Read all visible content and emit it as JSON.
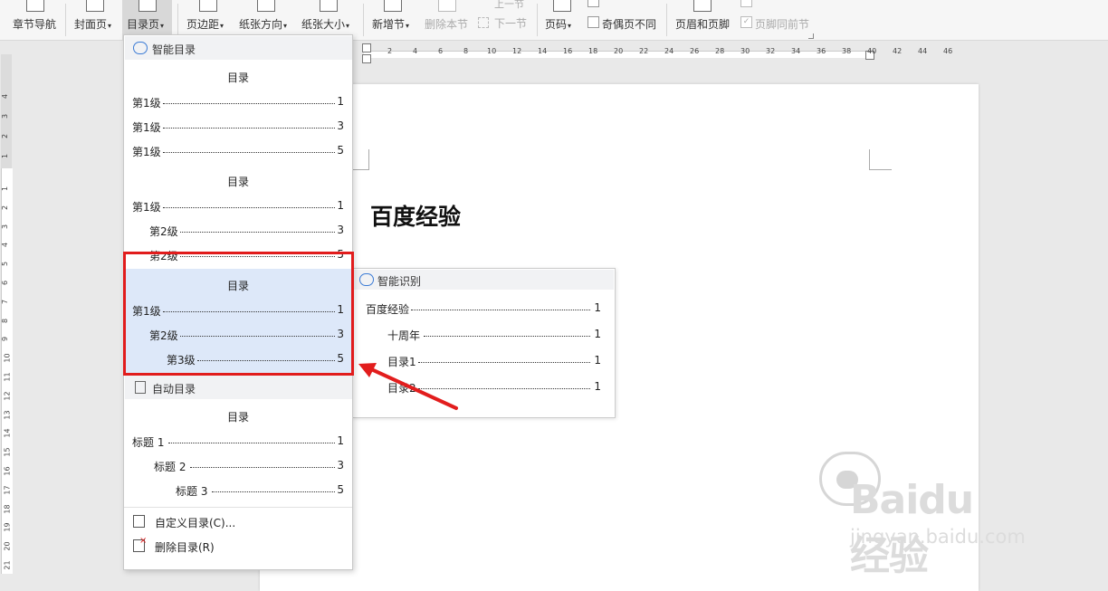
{
  "toolbar": {
    "chapter_nav": "章节导航",
    "cover_page": "封面页",
    "toc_page": "目录页",
    "margins": "页边距",
    "orientation": "纸张方向",
    "paper_size": "纸张大小",
    "new_section": "新增节",
    "delete_section": "删除本节",
    "prev_section": "上一节",
    "next_section": "下一节",
    "page_number": "页码",
    "odd_even_diff": "奇偶页不同",
    "header_footer": "页眉和页脚",
    "footer_same_prev": "页脚同前节"
  },
  "ruler": {
    "h_ticks": [
      "2",
      "4",
      "6",
      "8",
      "10",
      "12",
      "14",
      "16",
      "18",
      "20",
      "22",
      "24",
      "26",
      "28",
      "30",
      "32",
      "34",
      "36",
      "38",
      "40",
      "42",
      "44",
      "46"
    ],
    "v_ticks_top": [
      "4",
      "3",
      "2",
      "1"
    ],
    "v_ticks": [
      "1",
      "2",
      "3",
      "4",
      "5",
      "6",
      "7",
      "8",
      "9",
      "10",
      "11",
      "12",
      "13",
      "14",
      "15",
      "16",
      "17",
      "18",
      "19",
      "20",
      "21"
    ]
  },
  "document": {
    "title": "百度经验"
  },
  "dropdown": {
    "smart_toc_label": "智能目录",
    "toc1": {
      "title": "目录",
      "lines": [
        {
          "label": "第1级",
          "page": "1"
        },
        {
          "label": "第1级",
          "page": "3"
        },
        {
          "label": "第1级",
          "page": "5"
        }
      ]
    },
    "toc2": {
      "title": "目录",
      "lines": [
        {
          "label": "第1级",
          "page": "1"
        },
        {
          "label": "第2级",
          "page": "3"
        },
        {
          "label": "第2级",
          "page": "5"
        }
      ]
    },
    "toc3": {
      "title": "目录",
      "lines": [
        {
          "label": "第1级",
          "page": "1"
        },
        {
          "label": "第2级",
          "page": "3"
        },
        {
          "label": "第3级",
          "page": "5"
        }
      ]
    },
    "auto_toc_label": "自动目录",
    "auto_toc": {
      "title": "目录",
      "lines": [
        {
          "label": "标题 1",
          "page": "1"
        },
        {
          "label": "标题 2",
          "page": "3"
        },
        {
          "label": "标题 3",
          "page": "5"
        }
      ]
    },
    "custom_toc": "自定义目录(C)...",
    "delete_toc": "删除目录(R)"
  },
  "preview": {
    "header": "智能识别",
    "lines": [
      {
        "label": "百度经验",
        "page": "1"
      },
      {
        "label": "十周年",
        "page": "1"
      },
      {
        "label": "目录1",
        "page": "1"
      },
      {
        "label": "目录2",
        "page": "1"
      }
    ]
  },
  "watermark": {
    "brand": "Baidu经验",
    "url": "jingyan.baidu.com"
  },
  "colors": {
    "highlight_border": "#e11c1c",
    "selection_bg": "#dde8f9",
    "arrow": "#e21d1d"
  }
}
